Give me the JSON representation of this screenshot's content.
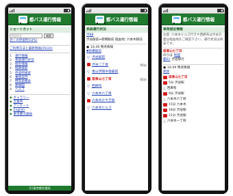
{
  "app": {
    "title": "都バス運行情報"
  },
  "status": {
    "battery": 0.7
  },
  "screen1": {
    "shortcut_label": "ショートカット",
    "input_placeholder": "停留所名",
    "search_label": "検索",
    "gps_link": "近くの停留所(GPS)",
    "recent_link": "ご利用方法と最新情報(05/24)",
    "menu": [
      {
        "num": "1",
        "label": "運行情報"
      },
      {
        "num": "2",
        "label": "系統運行状況"
      },
      {
        "num": "3",
        "label": "接近情報"
      },
      {
        "num": "4",
        "label": "経路検索"
      },
      {
        "num": "5",
        "label": "停留所検索"
      },
      {
        "num": "6",
        "label": "乗換案内"
      },
      {
        "num": "7",
        "label": "時刻表検索"
      },
      {
        "num": "8",
        "label": "路線図"
      },
      {
        "num": "9",
        "label": "ヘルプ"
      }
    ],
    "links": [
      "ギャラリー",
      "営業所",
      "アンケート",
      "English",
      "東京都交通局"
    ],
    "footer": "(C)東京都交通局"
  },
  "screen2": {
    "section": "系統運行状況",
    "route": "渋88",
    "route_desc": "渋谷駅前⇔新橋駅前 経由地: 六本木駅前",
    "updated": "16:49 時点情報",
    "direction_link": "▼新橋駅前",
    "stops": [
      {
        "name": "渋谷駅前",
        "time": "",
        "mark": "",
        "highlight": false
      },
      {
        "name": "渋谷二丁目",
        "time": "05分",
        "mark": "bus",
        "highlight": false
      },
      {
        "name": "青山学院中等部前",
        "time": "",
        "mark": "",
        "highlight": false
      },
      {
        "name": "南青山七丁目",
        "time": "02分",
        "mark": "bus",
        "highlight": true
      },
      {
        "name": "西麻布",
        "time": "",
        "mark": "",
        "highlight": false
      },
      {
        "name": "六本木六丁目",
        "time": "",
        "mark": "",
        "highlight": false
      },
      {
        "name": "六本木けやき坂",
        "time": "",
        "mark": "bus",
        "highlight": false
      },
      {
        "name": "六本木ヒルズ",
        "time": "",
        "mark": "",
        "highlight": false
      }
    ]
  },
  "screen3": {
    "section": "車両接近情報",
    "note": "注意: 六本木ヒルズ行きや西麻布は渋谷方面は経由地をご確認下さい。運行状況は目安です。",
    "stop_name": "南青山七丁目",
    "direction": "のりば",
    "route_link": "地図",
    "route": "都01",
    "destination": "渋谷駅行",
    "updated": "16:49 時点情報",
    "refresh": "更新",
    "approach": [
      {
        "label": "南青山七丁目",
        "type": "stop"
      },
      {
        "label": "5分 渋谷駅",
        "type": "bus"
      },
      {
        "label": "西麻布",
        "type": "plain"
      },
      {
        "label": "9分 渋谷駅",
        "type": "bus"
      },
      {
        "label": "六本木六丁目",
        "type": "plain"
      },
      {
        "label": "15分 六本木",
        "type": "bus"
      },
      {
        "label": "18分 渋谷駅",
        "type": "bus"
      },
      {
        "label": "21分 渋谷駅",
        "type": "bus"
      },
      {
        "label": "六本木一丁目",
        "type": "plain"
      }
    ]
  }
}
